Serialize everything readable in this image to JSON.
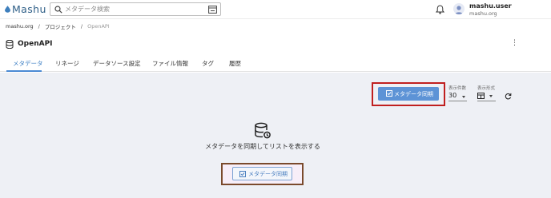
{
  "app": {
    "brand": "Mashu"
  },
  "search": {
    "placeholder": "メタデータ検索"
  },
  "user": {
    "name": "mashu.user",
    "org": "mashu.org"
  },
  "breadcrumb": {
    "items": [
      "mashu.org",
      "プロジェクト",
      "OpenAPI"
    ]
  },
  "page": {
    "title": "OpenAPI",
    "more_label": "⋮"
  },
  "tabs": [
    "メタデータ",
    "リネージ",
    "データソース設定",
    "ファイル情報",
    "タグ",
    "履歴"
  ],
  "toolbar": {
    "sync_label": "メタデータ同期",
    "count_label": "表示件数",
    "count_value": "30",
    "view_label": "表示形式"
  },
  "empty": {
    "message": "メタデータを同期してリストを表示する",
    "sync_label": "メタデータ同期"
  },
  "colors": {
    "accent": "#5d93d6",
    "highlight_red": "#c01f1f",
    "highlight_brown": "#7a4a2c"
  }
}
